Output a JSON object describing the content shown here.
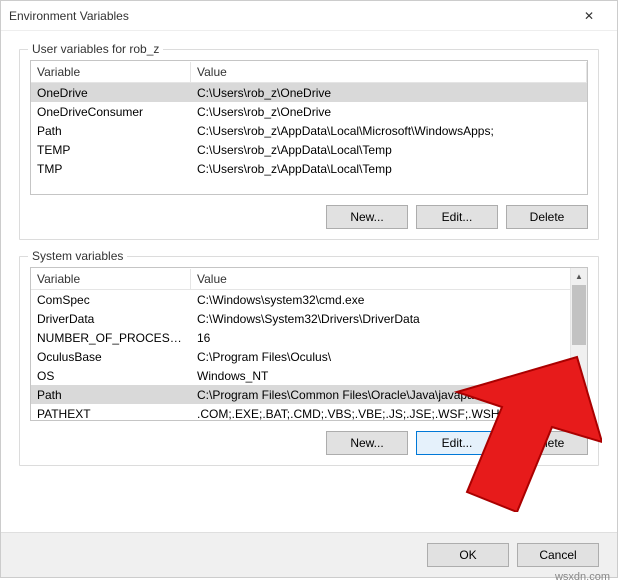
{
  "window": {
    "title": "Environment Variables",
    "close_label": "✕"
  },
  "user_section": {
    "label": "User variables for rob_z",
    "col_variable": "Variable",
    "col_value": "Value",
    "rows": [
      {
        "name": "OneDrive",
        "value": "C:\\Users\\rob_z\\OneDrive"
      },
      {
        "name": "OneDriveConsumer",
        "value": "C:\\Users\\rob_z\\OneDrive"
      },
      {
        "name": "Path",
        "value": "C:\\Users\\rob_z\\AppData\\Local\\Microsoft\\WindowsApps;"
      },
      {
        "name": "TEMP",
        "value": "C:\\Users\\rob_z\\AppData\\Local\\Temp"
      },
      {
        "name": "TMP",
        "value": "C:\\Users\\rob_z\\AppData\\Local\\Temp"
      }
    ],
    "buttons": {
      "new": "New...",
      "edit": "Edit...",
      "delete": "Delete"
    }
  },
  "system_section": {
    "label": "System variables",
    "col_variable": "Variable",
    "col_value": "Value",
    "rows": [
      {
        "name": "ComSpec",
        "value": "C:\\Windows\\system32\\cmd.exe"
      },
      {
        "name": "DriverData",
        "value": "C:\\Windows\\System32\\Drivers\\DriverData"
      },
      {
        "name": "NUMBER_OF_PROCESSORS",
        "value": "16"
      },
      {
        "name": "OculusBase",
        "value": "C:\\Program Files\\Oculus\\"
      },
      {
        "name": "OS",
        "value": "Windows_NT"
      },
      {
        "name": "Path",
        "value": "C:\\Program Files\\Common Files\\Oracle\\Java\\javapath;C:\\Program ..."
      },
      {
        "name": "PATHEXT",
        "value": ".COM;.EXE;.BAT;.CMD;.VBS;.VBE;.JS;.JSE;.WSF;.WSH;.MSC"
      }
    ],
    "selected_index": 5,
    "buttons": {
      "new": "New...",
      "edit": "Edit...",
      "delete": "Delete"
    }
  },
  "dialog_buttons": {
    "ok": "OK",
    "cancel": "Cancel"
  },
  "watermark": "wsxdn.com"
}
